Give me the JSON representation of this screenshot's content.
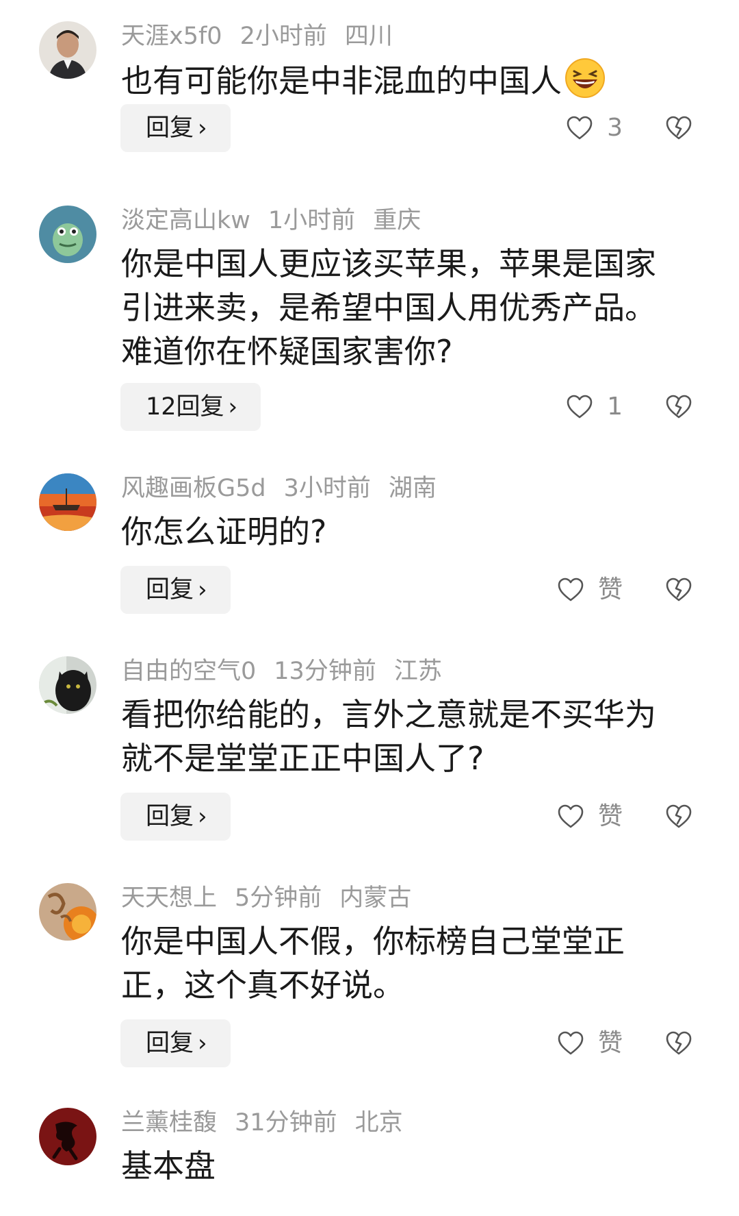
{
  "comments": [
    {
      "username": "天涯x5f0",
      "time": "2小时前",
      "location": "四川",
      "text": "也有可能你是中非混血的中国人",
      "has_emoji": true,
      "emoji_icon": "laughing-emoji-icon",
      "reply_label": "回复",
      "like_count": "3"
    },
    {
      "username": "淡定高山kw",
      "time": "1小时前",
      "location": "重庆",
      "text_lines": [
        "你是中国人更应该买苹果，苹果是国家",
        "引进来卖，是希望中国人用优秀产品。",
        "难道你在怀疑国家害你?"
      ],
      "reply_label": "12回复",
      "like_count": "1"
    },
    {
      "username": "风趣画板G5d",
      "time": "3小时前",
      "location": "湖南",
      "text": "你怎么证明的?",
      "reply_label": "回复",
      "like_count": "赞"
    },
    {
      "username": "自由的空气0",
      "time": "13分钟前",
      "location": "江苏",
      "text_lines": [
        "看把你给能的，言外之意就是不买华为",
        "就不是堂堂正正中国人了?"
      ],
      "reply_label": "回复",
      "like_count": "赞"
    },
    {
      "username": "天天想上",
      "time": "5分钟前",
      "location": "内蒙古",
      "text_lines": [
        "你是中国人不假，你标榜自己堂堂正",
        "正，这个真不好说。"
      ],
      "reply_label": "回复",
      "like_count": "赞"
    },
    {
      "username": "兰薰桂馥",
      "time": "31分钟前",
      "location": "北京",
      "text": "基本盘"
    }
  ],
  "icons": {
    "reply_chevron": "chevron-right-icon",
    "like": "heart-icon",
    "dislike": "broken-heart-icon"
  },
  "colors": {
    "meta_text": "#9a9a9a",
    "body_text": "#1a1a1a",
    "reply_bg": "#f2f2f2",
    "icon_stroke": "#555555"
  }
}
